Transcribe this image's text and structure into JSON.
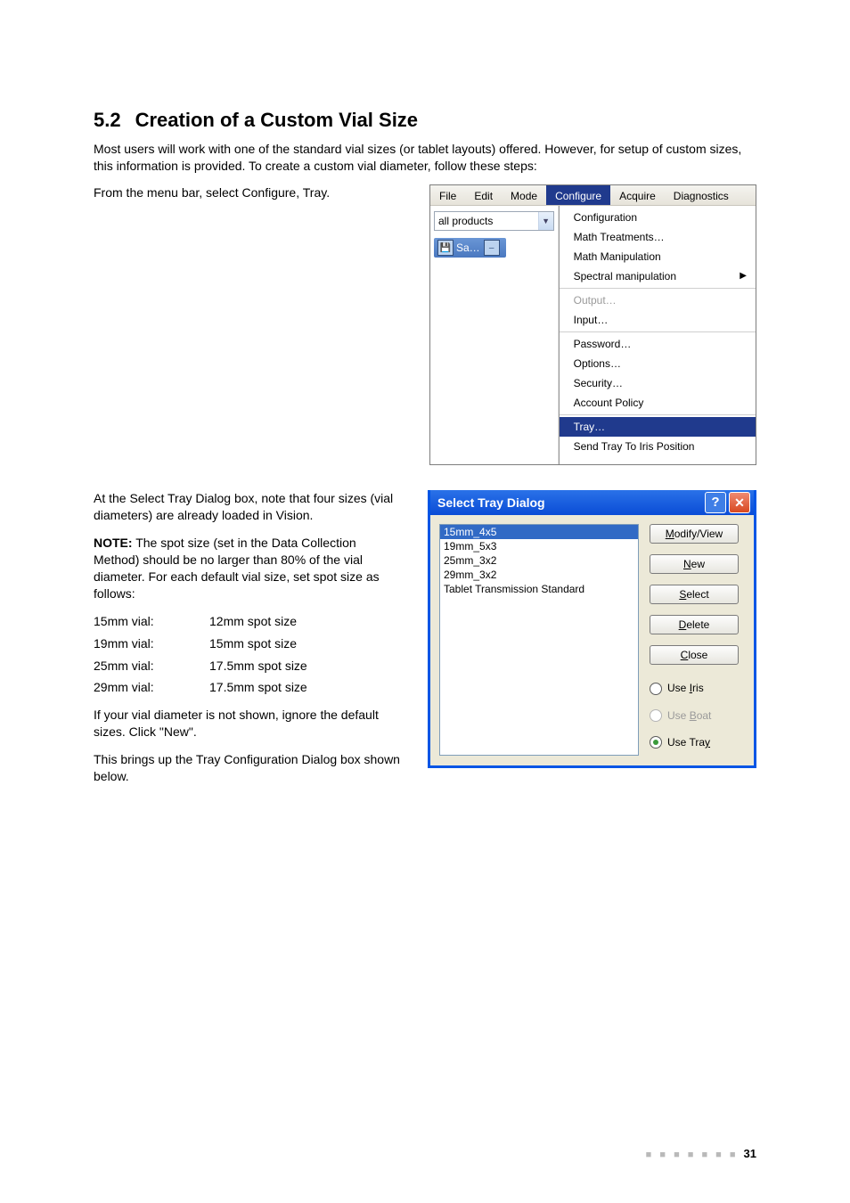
{
  "section": {
    "number": "5.2",
    "title": "Creation of a Custom Vial Size"
  },
  "intro": "Most users will work with one of the standard vial sizes (or tablet layouts) offered. However, for setup of custom sizes, this information is provided. To create a custom vial diameter, follow these steps:",
  "step1_text": "From the menu bar, select Configure, Tray.",
  "menubar": {
    "items": [
      "File",
      "Edit",
      "Mode",
      "Configure",
      "Acquire",
      "Diagnostics"
    ],
    "highlighted_index": 3
  },
  "combo_text": "all products",
  "toolbar_frag_text": "Sa…",
  "configure_menu": {
    "groups": [
      {
        "items": [
          {
            "text": "Configuration"
          },
          {
            "text": "Math Treatments…"
          },
          {
            "text": "Math Manipulation"
          },
          {
            "text": "Spectral manipulation",
            "submenu": true
          }
        ]
      },
      {
        "items": [
          {
            "text": "Output…",
            "disabled": true
          },
          {
            "text": "Input…"
          }
        ]
      },
      {
        "items": [
          {
            "text": "Password…"
          },
          {
            "text": "Options…"
          },
          {
            "text": "Security…"
          },
          {
            "text": "Account Policy"
          }
        ]
      },
      {
        "items": [
          {
            "text": "Tray…",
            "highlighted": true
          },
          {
            "text": "Send Tray To Iris Position"
          }
        ]
      }
    ]
  },
  "step2_text": "At the Select Tray Dialog box, note that four sizes (vial diameters) are already loaded in Vision.",
  "note_label": "NOTE:",
  "note_text": " The spot size (set in the Data Collection Method) should be no larger than 80% of the vial diameter. For each default vial size, set spot size as follows:",
  "spot_table": [
    {
      "vial": "15mm vial:",
      "spot": "12mm spot size"
    },
    {
      "vial": "19mm vial:",
      "spot": "15mm spot size"
    },
    {
      "vial": "25mm vial:",
      "spot": "17.5mm spot size"
    },
    {
      "vial": "29mm vial:",
      "spot": "17.5mm spot size"
    }
  ],
  "step2_tail1": "If your vial diameter is not shown, ignore the default sizes. Click \"New\".",
  "step2_tail2": "This brings up the Tray Configuration Dialog box shown below.",
  "dialog": {
    "title": "Select Tray Dialog",
    "list": [
      "15mm_4x5",
      "19mm_5x3",
      "25mm_3x2",
      "29mm_3x2",
      "Tablet Transmission Standard"
    ],
    "selected_index": 0,
    "buttons": {
      "modify": {
        "accel": "M",
        "rest": "odify/View"
      },
      "new": {
        "accel": "N",
        "rest": "ew"
      },
      "select": {
        "accel": "S",
        "rest": "elect"
      },
      "delete": {
        "accel": "D",
        "rest": "elete"
      },
      "close": {
        "accel": "C",
        "rest": "lose"
      }
    },
    "radios": {
      "iris": {
        "pre": "Use ",
        "accel": "I",
        "post": "ris"
      },
      "boat": {
        "pre": "Use ",
        "accel": "B",
        "post": "oat"
      },
      "tray": {
        "pre": "Use Tra",
        "accel": "y",
        "post": ""
      }
    }
  },
  "page_number": "31"
}
